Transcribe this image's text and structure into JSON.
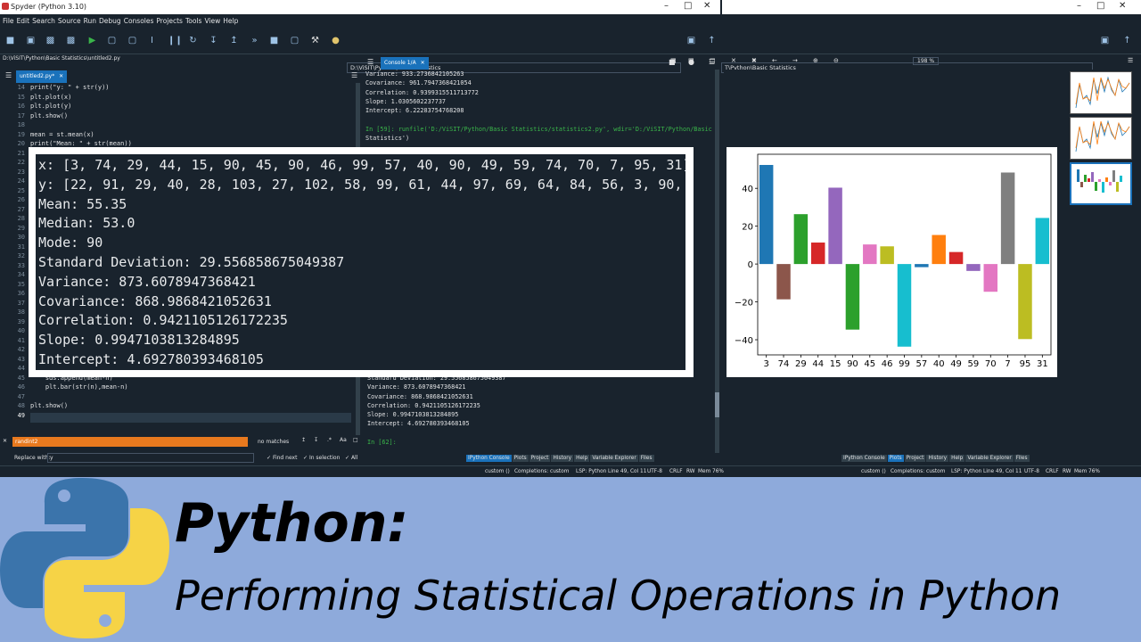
{
  "window": {
    "title": "Spyder (Python 3.10)"
  },
  "menu": [
    "File",
    "Edit",
    "Search",
    "Source",
    "Run",
    "Debug",
    "Consoles",
    "Projects",
    "Tools",
    "View",
    "Help"
  ],
  "toolbar": {
    "working_dir": "D:\\ViSIT\\Python\\Basic Statistics",
    "working_dir_right": "T\\Python\\Basic Statistics"
  },
  "editor": {
    "file_path": "D:\\ViSIT\\Python\\Basic Statistics\\untitled2.py",
    "tab_label": "untitled2.py*",
    "lines": [
      {
        "n": "14",
        "code": "print(\"y: \" + str(y))"
      },
      {
        "n": "15",
        "code": "plt.plot(x)"
      },
      {
        "n": "16",
        "code": "plt.plot(y)"
      },
      {
        "n": "17",
        "code": "plt.show()"
      },
      {
        "n": "18",
        "code": ""
      },
      {
        "n": "19",
        "code": "mean = st.mean(x)"
      },
      {
        "n": "20",
        "code": "print(\"Mean: \" + str(mean))"
      },
      {
        "n": "21",
        "code": ""
      },
      {
        "n": "22",
        "code": ""
      },
      {
        "n": "23",
        "code": ""
      },
      {
        "n": "24",
        "code": ""
      },
      {
        "n": "25",
        "code": ""
      },
      {
        "n": "26",
        "code": ""
      },
      {
        "n": "27",
        "code": ""
      },
      {
        "n": "28",
        "code": ""
      },
      {
        "n": "29",
        "code": ""
      },
      {
        "n": "30",
        "code": ""
      },
      {
        "n": "31",
        "code": ""
      },
      {
        "n": "32",
        "code": ""
      },
      {
        "n": "33",
        "code": ""
      },
      {
        "n": "34",
        "code": ""
      },
      {
        "n": "35",
        "code": ""
      },
      {
        "n": "36",
        "code": ""
      },
      {
        "n": "37",
        "code": ""
      },
      {
        "n": "38",
        "code": ""
      },
      {
        "n": "39",
        "code": ""
      },
      {
        "n": "40",
        "code": ""
      },
      {
        "n": "41",
        "code": ""
      },
      {
        "n": "42",
        "code": ""
      },
      {
        "n": "43",
        "code": ""
      },
      {
        "n": "44",
        "code": "for n in x:"
      },
      {
        "n": "45",
        "code": "    sds.append(mean-n)"
      },
      {
        "n": "46",
        "code": "    plt.bar(str(n),mean-n)"
      },
      {
        "n": "47",
        "code": ""
      },
      {
        "n": "48",
        "code": "plt.show()"
      },
      {
        "n": "49",
        "code": ""
      }
    ]
  },
  "find": {
    "search_value": "randint2",
    "matches": "no matches",
    "replace_label": "Replace with:",
    "replace_value": "y",
    "find_next": "Find next",
    "in_selection": "In selection",
    "all": "All"
  },
  "console": {
    "tab_label": "Console 1/A",
    "top_lines": [
      "Variance: 933.2736842105263",
      "Covariance: 961.7947368421054",
      "Correlation: 0.9399315511713772",
      "Slope: 1.0305602237737",
      "Intercept: 6.22283754768208",
      "",
      "In [59]: runfile('D:/ViSIT/Python/Basic Statistics/statistics2.py', wdir='D:/ViSIT/Python/Basic",
      "Statistics')"
    ],
    "bottom_lines": [
      "Standard Deviation: 29.556858675049387",
      "Variance: 873.6078947368421",
      "Covariance: 868.9868421052631",
      "Correlation: 0.9421105126172235",
      "Slope: 0.9947103813284895",
      "Intercept: 4.692780393468105",
      "",
      "In [62]:"
    ]
  },
  "bottom_tabs_left": [
    "IPython Console",
    "Plots",
    "Project",
    "History",
    "Help",
    "Variable Explorer",
    "Files"
  ],
  "bottom_tabs_right": [
    "IPython Console",
    "Plots",
    "Project",
    "History",
    "Help",
    "Variable Explorer",
    "Files"
  ],
  "plots_toolbar": {
    "zoom": "198 %"
  },
  "status": {
    "left": [
      "custom ()",
      "Completions: custom",
      "LSP: Python",
      "Line 49, Col 11",
      "UTF-8",
      "CRLF",
      "RW",
      "Mem 76%"
    ],
    "right": [
      "custom ()",
      "Completions: custom",
      "LSP: Python",
      "Line 49, Col 11",
      "UTF-8",
      "CRLF",
      "RW",
      "Mem 76%"
    ]
  },
  "overlay_output": [
    "x: [3, 74, 29, 44, 15, 90, 45, 90, 46, 99, 57, 40, 90, 49, 59, 74, 70, 7, 95, 31]",
    "y: [22, 91, 29, 40, 28, 103, 27, 102, 58, 99, 61, 44, 97, 69, 64, 84, 56, 3, 90, 28]",
    "Mean: 55.35",
    "Median: 53.0",
    "Mode: 90",
    "Standard Deviation: 29.556858675049387",
    "Variance: 873.6078947368421",
    "Covariance: 868.9868421052631",
    "Correlation: 0.9421105126172235",
    "Slope: 0.9947103813284895",
    "Intercept: 4.692780393468105"
  ],
  "banner": {
    "title": "Python:",
    "subtitle": "Performing Statistical Operations in Python"
  },
  "chart_data": {
    "type": "bar",
    "categories": [
      "3",
      "74",
      "29",
      "44",
      "15",
      "90",
      "45",
      "46",
      "99",
      "57",
      "40",
      "49",
      "59",
      "70",
      "7",
      "95",
      "31"
    ],
    "values": [
      52.35,
      -18.65,
      26.35,
      11.35,
      40.35,
      -34.65,
      10.35,
      9.35,
      -43.65,
      -1.65,
      15.35,
      6.35,
      -3.65,
      -14.65,
      48.35,
      -39.65,
      24.35
    ],
    "colors": [
      "#1f77b4",
      "#8c564b",
      "#2ca02c",
      "#d62728",
      "#9467bd",
      "#2ca02c",
      "#e377c2",
      "#bcbd22",
      "#17becf",
      "#1f77b4",
      "#ff7f0e",
      "#d62728",
      "#9467bd",
      "#e377c2",
      "#7f7f7f",
      "#bcbd22",
      "#17becf"
    ],
    "yticks": [
      "40",
      "20",
      "0",
      "−20",
      "−40"
    ],
    "ylim": [
      -48,
      58
    ],
    "title": "",
    "xlabel": "",
    "ylabel": ""
  }
}
